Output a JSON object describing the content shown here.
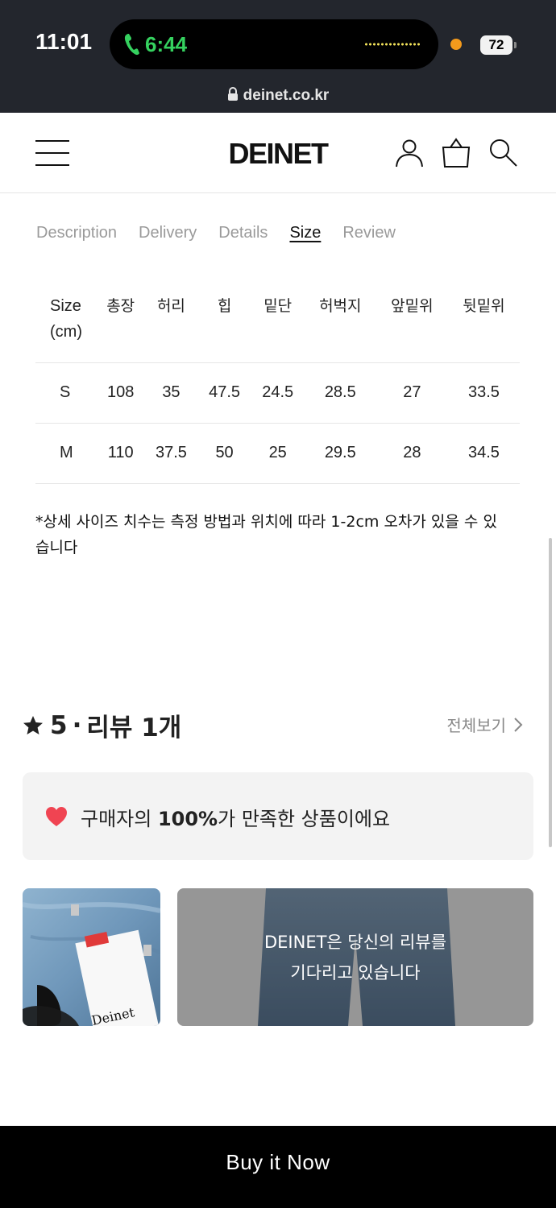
{
  "status_bar": {
    "time": "11:01",
    "call_time": "6:44",
    "battery": "72",
    "url": "deinet.co.kr"
  },
  "header": {
    "logo": "DEINET"
  },
  "tabs": [
    {
      "label": "Description"
    },
    {
      "label": "Delivery"
    },
    {
      "label": "Details"
    },
    {
      "label": "Size",
      "active": true
    },
    {
      "label": "Review"
    }
  ],
  "size_table": {
    "header_size": "Size",
    "header_unit": "(cm)",
    "columns": [
      "총장",
      "허리",
      "힙",
      "밑단",
      "허벅지",
      "앞밑위",
      "뒷밑위"
    ],
    "rows": [
      {
        "size": "S",
        "values": [
          "108",
          "35",
          "47.5",
          "24.5",
          "28.5",
          "27",
          "33.5"
        ]
      },
      {
        "size": "M",
        "values": [
          "110",
          "37.5",
          "50",
          "25",
          "29.5",
          "28",
          "34.5"
        ]
      }
    ]
  },
  "size_note": "*상세 사이즈 치수는 측정 방법과 위치에 따라 1-2cm 오차가 있을 수 있습니다",
  "reviews": {
    "rating": "5",
    "separator": "·",
    "count_label": "리뷰 1개",
    "view_all": "전체보기",
    "satisfaction_pre": "구매자의 ",
    "satisfaction_pct": "100%",
    "satisfaction_post": "가 만족한 상품이에요",
    "placeholder_line1": "DEINET은 당신의 리뷰를",
    "placeholder_line2": "기다리고 있습니다",
    "photo_tag_text": "Deinet"
  },
  "buy_button": "Buy it Now",
  "colors": {
    "status_bg": "#23262d",
    "call_green": "#35d15f",
    "heart": "#f04452",
    "button_bg": "#000000",
    "tab_inactive": "#9a9a9a"
  }
}
